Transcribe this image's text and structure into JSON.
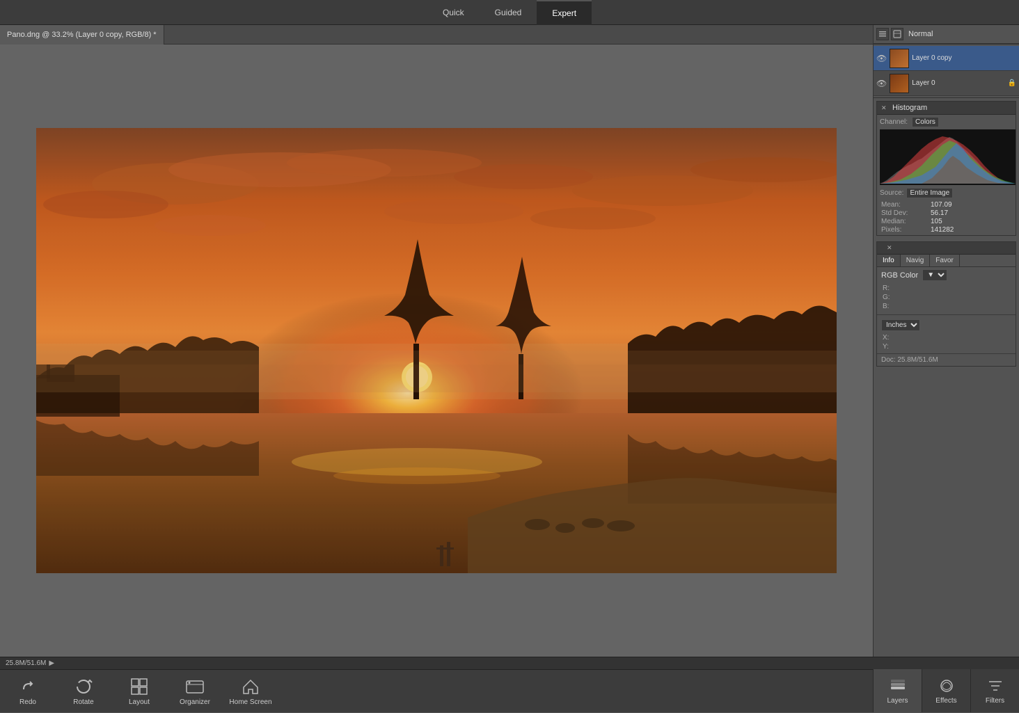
{
  "topbar": {
    "tabs": [
      {
        "id": "quick",
        "label": "Quick",
        "active": false
      },
      {
        "id": "guided",
        "label": "Guided",
        "active": false
      },
      {
        "id": "expert",
        "label": "Expert",
        "active": true
      }
    ]
  },
  "docTab": {
    "title": "Pano.dng @ 33.2% (Layer 0 copy, RGB/8) *"
  },
  "layers": {
    "blendMode": "Normal",
    "items": [
      {
        "name": "Layer 0 copy",
        "active": true
      },
      {
        "name": "Layer 0",
        "active": false
      }
    ]
  },
  "histogram": {
    "title": "Histogram",
    "channelLabel": "Channel:",
    "channel": "Colors",
    "sourceLabel": "Source:",
    "source": "Entire Image",
    "stats": {
      "mean_label": "Mean:",
      "mean_val": "107.09",
      "stddev_label": "Std Dev:",
      "stddev_val": "56.17",
      "median_label": "Median:",
      "median_val": "105",
      "pixels_label": "Pixels:",
      "pixels_val": "141282"
    }
  },
  "info": {
    "tabs": [
      {
        "label": "Info",
        "active": true
      },
      {
        "label": "Navig",
        "active": false
      },
      {
        "label": "Favor",
        "active": false
      }
    ],
    "colorModel": "RGB Color",
    "r_label": "R:",
    "r_val": "",
    "g_label": "G:",
    "g_val": "",
    "b_label": "B:",
    "b_val": "",
    "unit": "Inches",
    "x_label": "X:",
    "x_val": "",
    "y_label": "Y:",
    "y_val": "",
    "doc_label": "Doc:",
    "doc_val": "25.8M/51.6M"
  },
  "bottombar": {
    "status": "25.8M/51.6M",
    "tools": [
      {
        "id": "redo",
        "label": "Redo"
      },
      {
        "id": "rotate",
        "label": "Rotate"
      },
      {
        "id": "layout",
        "label": "Layout"
      },
      {
        "id": "organizer",
        "label": "Organizer"
      },
      {
        "id": "home-screen",
        "label": "Home Screen"
      }
    ],
    "rightButtons": [
      {
        "id": "layers",
        "label": "Layers",
        "active": true
      },
      {
        "id": "effects",
        "label": "Effects",
        "active": false
      },
      {
        "id": "filters",
        "label": "Filters",
        "active": false
      }
    ]
  }
}
